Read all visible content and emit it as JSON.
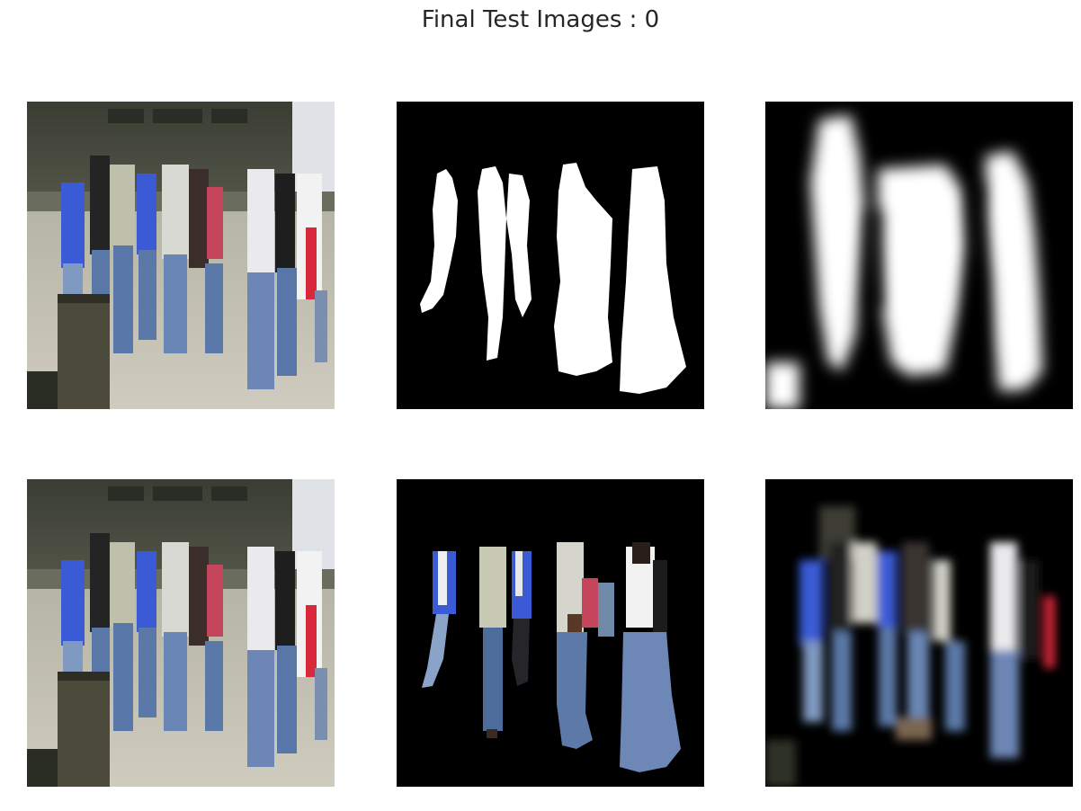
{
  "figure": {
    "title": "Final Test Images : 0"
  },
  "panels": [
    {
      "id": "original-top",
      "content": "original-photo"
    },
    {
      "id": "ground-truth-mask",
      "content": "binary-mask"
    },
    {
      "id": "predicted-mask",
      "content": "soft-mask"
    },
    {
      "id": "original-bottom",
      "content": "original-photo"
    },
    {
      "id": "ground-truth-cutout",
      "content": "masked-photo"
    },
    {
      "id": "predicted-cutout",
      "content": "masked-photo"
    }
  ],
  "colors": {
    "background": "#ffffff",
    "title": "#262626",
    "mask_bg": "#000000",
    "mask_fg": "#ffffff",
    "denim": "#5b79a8",
    "jacket_blue": "#3b5bd6",
    "red_stripe": "#d8283a",
    "pavement": "#b9b6a8",
    "building": "#4a4c40"
  }
}
